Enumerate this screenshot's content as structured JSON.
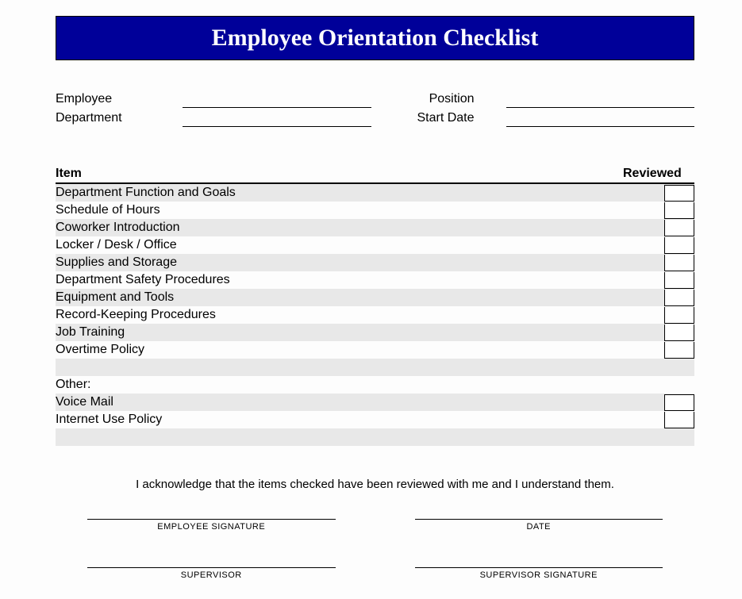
{
  "title": "Employee Orientation Checklist",
  "info": {
    "employee_label": "Employee",
    "department_label": "Department",
    "position_label": "Position",
    "startdate_label": "Start Date"
  },
  "headers": {
    "item": "Item",
    "reviewed": "Reviewed"
  },
  "items": [
    {
      "label": "Department Function and Goals",
      "shade": true,
      "box": true
    },
    {
      "label": "Schedule of Hours",
      "shade": false,
      "box": true
    },
    {
      "label": "Coworker Introduction",
      "shade": true,
      "box": true
    },
    {
      "label": "Locker / Desk / Office",
      "shade": false,
      "box": true
    },
    {
      "label": "Supplies and Storage",
      "shade": true,
      "box": true
    },
    {
      "label": "Department Safety Procedures",
      "shade": false,
      "box": true
    },
    {
      "label": "Equipment and Tools",
      "shade": true,
      "box": true
    },
    {
      "label": "Record-Keeping Procedures",
      "shade": false,
      "box": true
    },
    {
      "label": "Job Training",
      "shade": true,
      "box": true
    },
    {
      "label": "Overtime Policy",
      "shade": false,
      "box": true
    },
    {
      "label": "",
      "shade": true,
      "box": false
    },
    {
      "label": "Other:",
      "shade": false,
      "box": false
    },
    {
      "label": "Voice Mail",
      "shade": true,
      "box": true
    },
    {
      "label": "Internet Use Policy",
      "shade": false,
      "box": true
    },
    {
      "label": "",
      "shade": true,
      "box": false
    }
  ],
  "acknowledgement": "I acknowledge that the items checked have been reviewed with me and I understand them.",
  "signatures": {
    "emp_sig": "EMPLOYEE SIGNATURE",
    "date": "DATE",
    "supervisor": "SUPERVISOR",
    "supervisor_sig": "SUPERVISOR SIGNATURE"
  }
}
